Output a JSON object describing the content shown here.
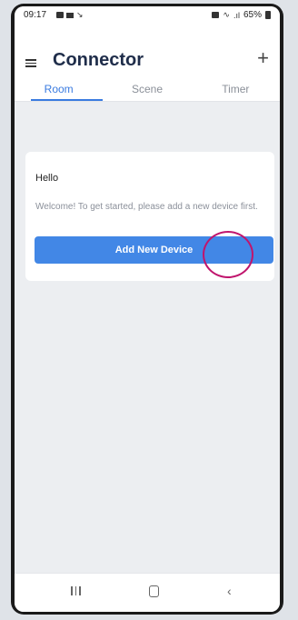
{
  "status_bar": {
    "time": "09:17",
    "battery": "65%"
  },
  "header": {
    "title": "Connector"
  },
  "tabs": [
    {
      "label": "Room",
      "active": true
    },
    {
      "label": "Scene",
      "active": false
    },
    {
      "label": "Timer",
      "active": false
    }
  ],
  "card": {
    "greeting": "Hello",
    "message": "Welcome! To get started, please add a new device first.",
    "button_label": "Add New Device"
  },
  "colors": {
    "accent": "#3a7be0",
    "button": "#4287e6",
    "marker": "#c0156d"
  },
  "icons": [
    "menu-icon",
    "plus-icon",
    "recent-apps-icon",
    "home-icon",
    "back-icon"
  ]
}
